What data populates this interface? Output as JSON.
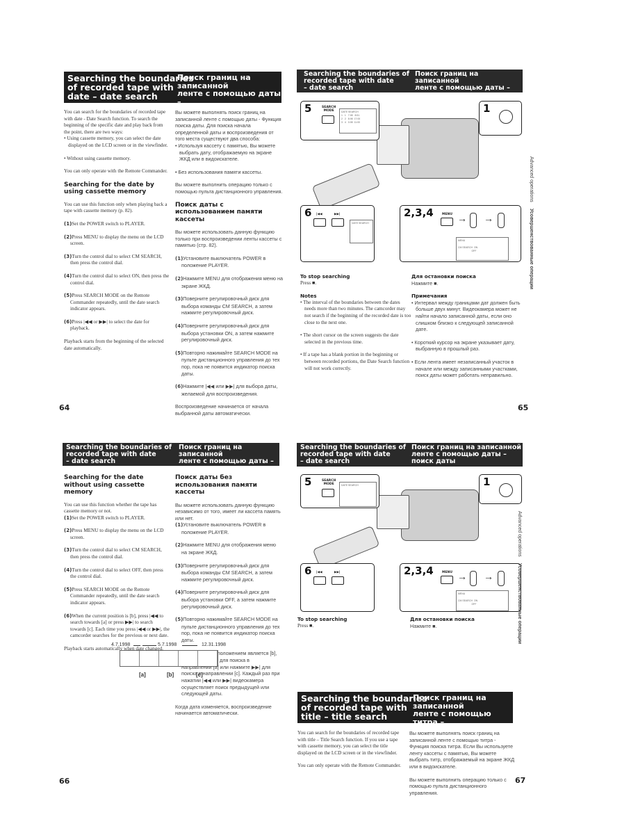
{
  "p64": {
    "header_en": "Searching the boundaries\nof recorded tape with\ndate – date search",
    "header_ru": "Поиск границ на записанной\nленте с помощью даты –\nпоиск даты",
    "en_intro": "You can search for the boundaries of recorded tape with date - Date Search function. To search the beginning of the specific date and play back from the point, there are two ways:",
    "en_bullets": [
      "• Using cassette memory, you can select the date displayed on the LCD screen or in the viewfinder.",
      "• Without using cassette memory."
    ],
    "en_remote": "You can only operate with the Remote Commander.",
    "en_sub": "Searching for the date by using cassette memory",
    "en_sub_intro": "You can use this function only when playing back a tape with cassette memory (p. 82).",
    "en_steps": [
      {
        "n": "(1)",
        "t": "Set the POWER switch to PLAYER."
      },
      {
        "n": "(2)",
        "t": "Press MENU to display the menu on the LCD screen."
      },
      {
        "n": "(3)",
        "t": "Turn the control dial to select CM SEARCH, then press the control dial."
      },
      {
        "n": "(4)",
        "t": "Turn the control dial to select ON, then press the control dial."
      },
      {
        "n": "(5)",
        "t": "Press SEARCH MODE on the Remote Commander repeatedly, until the date search indicator appears."
      },
      {
        "n": "(6)",
        "t": "Press |◀◀ or ▶▶| to select the date for playback."
      }
    ],
    "en_outro": "Playback starts from the beginning of the selected date automatically.",
    "ru_intro": "Вы можете выполнять поиск границ на записанной ленте с помощью даты - Функция поиска даты. Для поиска начала определенной даты и воспроизведения от того места существуют два способа:",
    "ru_bullets": [
      "• Используя кассету с памятью, Вы можете выбрать дату, отображаемую на экране ЖКД или в видоискателе.",
      "• Без использования памяти кассеты."
    ],
    "ru_remote": "Вы можете выполнить операцию только с помощью пульта дистанционного управления.",
    "ru_sub": "Поиск даты с использованием памяти кассеты",
    "ru_sub_intro": "Вы можете использовать данную функцию только при воспроизведении ленты кассеты с памятью (стр. 82).",
    "ru_steps": [
      {
        "n": "(1)",
        "t": "Установите выключатель POWER в положение PLAYER."
      },
      {
        "n": "(2)",
        "t": "Нажмите MENU для отображения меню на экране ЖКД."
      },
      {
        "n": "(3)",
        "t": "Поверните регулировочный диск для выбора команды CM SEARCH, а затем нажмите регулировочный диск."
      },
      {
        "n": "(4)",
        "t": "Поверните регулировочный диск для выбора установки ON, а затем нажмите регулировочный диск."
      },
      {
        "n": "(5)",
        "t": "Повторно нажимайте SEARCH MODE на пульте дистанционного управления до тех пор, пока не появится индикатор поиска даты."
      },
      {
        "n": "(6)",
        "t": "Нажмите |◀◀ или ▶▶| для выбора даты, желаемой для воспроизведения."
      }
    ],
    "ru_outro": "Воспроизведение начинается от начала выбранной даты автоматически.",
    "page_number": "64"
  },
  "p65": {
    "header_en": "Searching the boundaries of\nrecorded tape with date\n– date search",
    "header_ru": "Поиск границ на записанной\nленте с помощью даты –\nпоиск даты",
    "illustration": {
      "steps": [
        "5",
        "1",
        "6",
        "2,3,4"
      ],
      "search_mode": "SEARCH\nMODE",
      "menu": "MENU",
      "screen_title": "DATE SEARCH",
      "screen_rows": "1   1   7.98   8:51\n2   2   8.98  17:00\n3   4   0.98  11:00",
      "menu_screen": "MENU",
      "cm_search": "CM SEARCH  ON\n                    OFF"
    },
    "stop_en": "To stop searching",
    "stop_en_text": "Press ■.",
    "stop_ru": "Для остановки поиска",
    "stop_ru_text": "Нажмите ■.",
    "notes_en": "Notes",
    "notes_en_items": [
      "• The interval of the boundaries between the dates needs more than two minutes. The camcorder may not search if the beginning of the recorded date is too close to the next one.",
      "• The short cursor on the screen suggests the date selected in the previous time.",
      "• If a tape has a blank portion in the beginning or between recorded portions, the Date Search function will not work correctly."
    ],
    "notes_ru": "Примечания",
    "notes_ru_items": [
      "• Интервал между границами дат должен быть больше двух минут. Видеокамера может не найти начало записанной даты, если оно слишком близко к следующей записанной дате.",
      "• Короткий курсор на экране указывает дату, выбранную в прошлый раз.",
      "• Если лента имеет незаписанный участок в начале или между записанными участками, поиск даты может работать неправильно."
    ],
    "side_en": "Advanced operations",
    "side_ru": "Усовершенствованные операции",
    "page_number": "65"
  },
  "p66": {
    "header_en": "Searching the boundaries of\nrecorded tape with date\n– date search",
    "header_ru": "Поиск границ на записанной\nленте с помощью даты –\nпоиск даты",
    "en_sub": "Searching for the date without using cassette memory",
    "en_intro": "You can use this function whether the tape has cassette memory or not.",
    "en_steps": [
      {
        "n": "(1)",
        "t": "Set the POWER switch to PLAYER."
      },
      {
        "n": "(2)",
        "t": "Press MENU to display the menu on the LCD screen."
      },
      {
        "n": "(3)",
        "t": "Turn the control dial to select CM SEARCH, then press the control dial."
      },
      {
        "n": "(4)",
        "t": "Turn the control dial to select OFF, then press the control dial."
      },
      {
        "n": "(5)",
        "t": "Press SEARCH MODE on the Remote Commander repeatedly, until the date search indicator appears."
      },
      {
        "n": "(6)",
        "t": "When the current position is [b], press |◀◀ to search towards [a] or press ▶▶| to search towards [c]. Each time you press |◀◀ or ▶▶|, the camcorder searches for the previous or next date."
      }
    ],
    "en_outro": "Playback starts automatically when date changed.",
    "ru_sub": "Поиск даты без использования памяти кассеты",
    "ru_intro": "Вы можете использовать данную функцию независимо от того, имеет ли кассета память или нет.",
    "ru_steps": [
      {
        "n": "(1)",
        "t": "Установите выключатель POWER в положение PLAYER."
      },
      {
        "n": "(2)",
        "t": "Нажмите MENU для отображения меню на экране ЖКД."
      },
      {
        "n": "(3)",
        "t": "Поверните регулировочный диск для выбора команды CM SEARCH, а затем нажмите регулировочный диск."
      },
      {
        "n": "(4)",
        "t": "Поверните регулировочный диск для выбора установки OFF, а затем нажмите регулировочный диск."
      },
      {
        "n": "(5)",
        "t": "Повторно нажимайте SEARCH MODE на пульте дистанционного управления до тех пор, пока не появится индикатор поиска даты."
      },
      {
        "n": "(6)",
        "t": "Если текущим положением является [b], то нажмите |◀◀ для поиска в направлении [a] или нажмите ▶▶| для поиска в направлении [c]. Каждый раз при нажатии |◀◀ или ▶▶| видеокамера осуществляет поиск предыдущей или следующей даты."
      }
    ],
    "ru_outro": "Когда дата изменяется, воспроизведение начинается автоматически.",
    "timeline": {
      "dates": [
        "4.7.1998",
        "5.7.1998",
        "12.31.1998"
      ],
      "markers": [
        "[a]",
        "[b]",
        "[c]"
      ]
    },
    "page_number": "66"
  },
  "p66r": {
    "header_en": "Searching the boundaries of\nrecorded tape with date\n– date search",
    "header_ru": "Поиск границ на записанной\nленте с помощью даты –\nпоиск даты",
    "illustration": {
      "steps": [
        "5",
        "1",
        "6",
        "2,3,4"
      ],
      "search_mode": "SEARCH\nMODE",
      "menu": "MENU",
      "screen_title": "DATE SEARCH",
      "menu_screen": "MENU",
      "cm_search": "CM SEARCH  ON\n                    OFF"
    },
    "stop_en": "To stop searching",
    "stop_en_text": "Press ■.",
    "stop_ru": "Для остановки поиска",
    "stop_ru_text": "Нажмите ■.",
    "side_en": "Advanced operations",
    "side_ru": "Усовершенствованные операции"
  },
  "p67": {
    "header_en": "Searching the boundaries\nof recorded tape with\ntitle – title search",
    "header_ru": "Поиск границ на записанной\nленте с помощью титра –\nпоиск титра",
    "en_intro": "You can search for the boundaries of recorded tape with title – Title Search function. If you use a tape with cassette memory, you can select the title displayed on the LCD screen or in the viewfinder.",
    "en_remote": "You can only operate with the Remote Commander.",
    "ru_intro": "Вы можете выполнять поиск границ на записанной ленте с помощью титра - Функция поиска титра. Если Вы используете ленту кассеты с памятью, Вы можете выбрать титр, отображаемый на экране ЖКД или в видоискателе.",
    "ru_remote": "Вы можете выполнить операцию только с помощью пульта дистанционного управления.",
    "page_number": "67"
  }
}
